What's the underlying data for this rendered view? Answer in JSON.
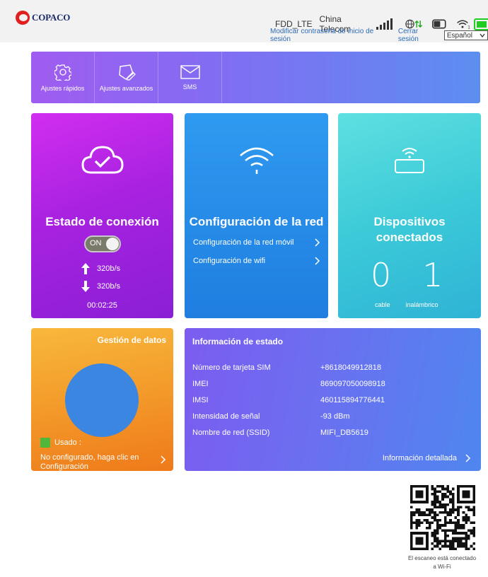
{
  "header": {
    "brand": "COPACO",
    "network_mode": "FDD_LTE",
    "carrier": "China Telecom",
    "change_password_link": "Modificar contraseña de inicio de sesión",
    "logout_link": "Cerrar sesión",
    "language": "Español"
  },
  "menu": [
    {
      "label": "Ajustes rápidos",
      "icon": "gear-icon"
    },
    {
      "label": "Ajustes avanzados",
      "icon": "settings-pen-icon"
    },
    {
      "label": "SMS",
      "icon": "envelope-icon"
    }
  ],
  "connection": {
    "title": "Estado de conexión",
    "toggle_label": "ON",
    "upload_rate": "320b/s",
    "download_rate": "320b/s",
    "duration": "00:02:25"
  },
  "network": {
    "title": "Configuración de la red",
    "mobile_link": "Configuración de la red móvil",
    "wifi_link": "Configuración de wifi"
  },
  "devices": {
    "title_line1": "Dispositivos",
    "title_line2": "conectados",
    "cable_count": "0",
    "wireless_count": "1",
    "cable_label": "cable",
    "wireless_label": "inalámbrico"
  },
  "data_mgmt": {
    "title": "Gestión de datos",
    "used_label": "Usado :",
    "not_configured": "No configurado, haga clic en Configuración",
    "pie_color": "#3a86e0",
    "used_color": "#4fb83a"
  },
  "status_info": {
    "title": "Información de estado",
    "rows": [
      {
        "label": "Número de tarjeta SIM",
        "value": "+8618049912818"
      },
      {
        "label": "IMEI",
        "value": "869097050098918"
      },
      {
        "label": "IMSI",
        "value": "460115894776441"
      },
      {
        "label": "Intensidad de señal",
        "value": "-93 dBm"
      },
      {
        "label": "Nombre de red (SSID)",
        "value": "MIFI_DB5619"
      }
    ],
    "detail_link": "Información detallada"
  },
  "qr": {
    "caption_line1": "El escaneo está conectado",
    "caption_line2": "a Wi-Fi"
  }
}
